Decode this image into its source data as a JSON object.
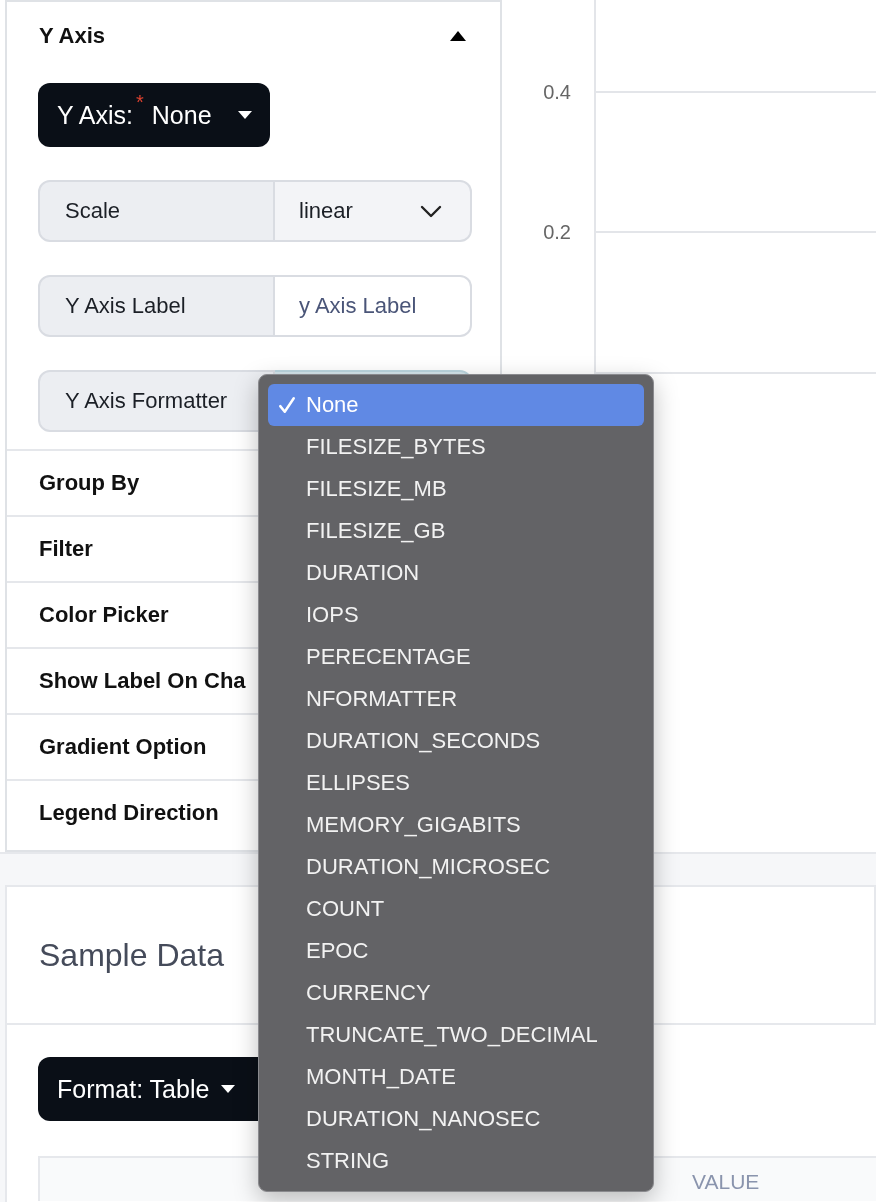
{
  "y_axis_section": {
    "title": "Y Axis",
    "expanded": true,
    "y_axis_button": {
      "label": "Y Axis:",
      "required_mark": "*",
      "value": "None"
    },
    "fields": [
      {
        "kind": "select",
        "label": "Scale",
        "value": "linear"
      },
      {
        "kind": "text",
        "label": "Y Axis Label",
        "placeholder": "y Axis Label"
      },
      {
        "kind": "select",
        "label": "Y Axis Formatter",
        "focused": true
      }
    ]
  },
  "sections": [
    {
      "title": "Group By"
    },
    {
      "title": "Filter"
    },
    {
      "title": "Color Picker"
    },
    {
      "title": "Show Label On Cha"
    },
    {
      "title": "Gradient Option"
    },
    {
      "title": "Legend Direction"
    }
  ],
  "chart": {
    "y_tick_labels": [
      "0.4",
      "0.2"
    ]
  },
  "sample_data": {
    "title": "Sample Data",
    "format_button": {
      "label": "Format: Table"
    },
    "table": {
      "columns": [
        "VALUE"
      ]
    }
  },
  "formatter_menu": {
    "options": [
      {
        "label": "None",
        "selected": true
      },
      {
        "label": "FILESIZE_BYTES",
        "selected": false
      },
      {
        "label": "FILESIZE_MB",
        "selected": false
      },
      {
        "label": "FILESIZE_GB",
        "selected": false
      },
      {
        "label": "DURATION",
        "selected": false
      },
      {
        "label": "IOPS",
        "selected": false
      },
      {
        "label": "PERECENTAGE",
        "selected": false
      },
      {
        "label": "NFORMATTER",
        "selected": false
      },
      {
        "label": "DURATION_SECONDS",
        "selected": false
      },
      {
        "label": "ELLIPSES",
        "selected": false
      },
      {
        "label": "MEMORY_GIGABITS",
        "selected": false
      },
      {
        "label": "DURATION_MICROSEC",
        "selected": false
      },
      {
        "label": "COUNT",
        "selected": false
      },
      {
        "label": "EPOC",
        "selected": false
      },
      {
        "label": "CURRENCY",
        "selected": false
      },
      {
        "label": "TRUNCATE_TWO_DECIMAL",
        "selected": false
      },
      {
        "label": "MONTH_DATE",
        "selected": false
      },
      {
        "label": "DURATION_NANOSEC",
        "selected": false
      },
      {
        "label": "STRING",
        "selected": false
      }
    ]
  }
}
